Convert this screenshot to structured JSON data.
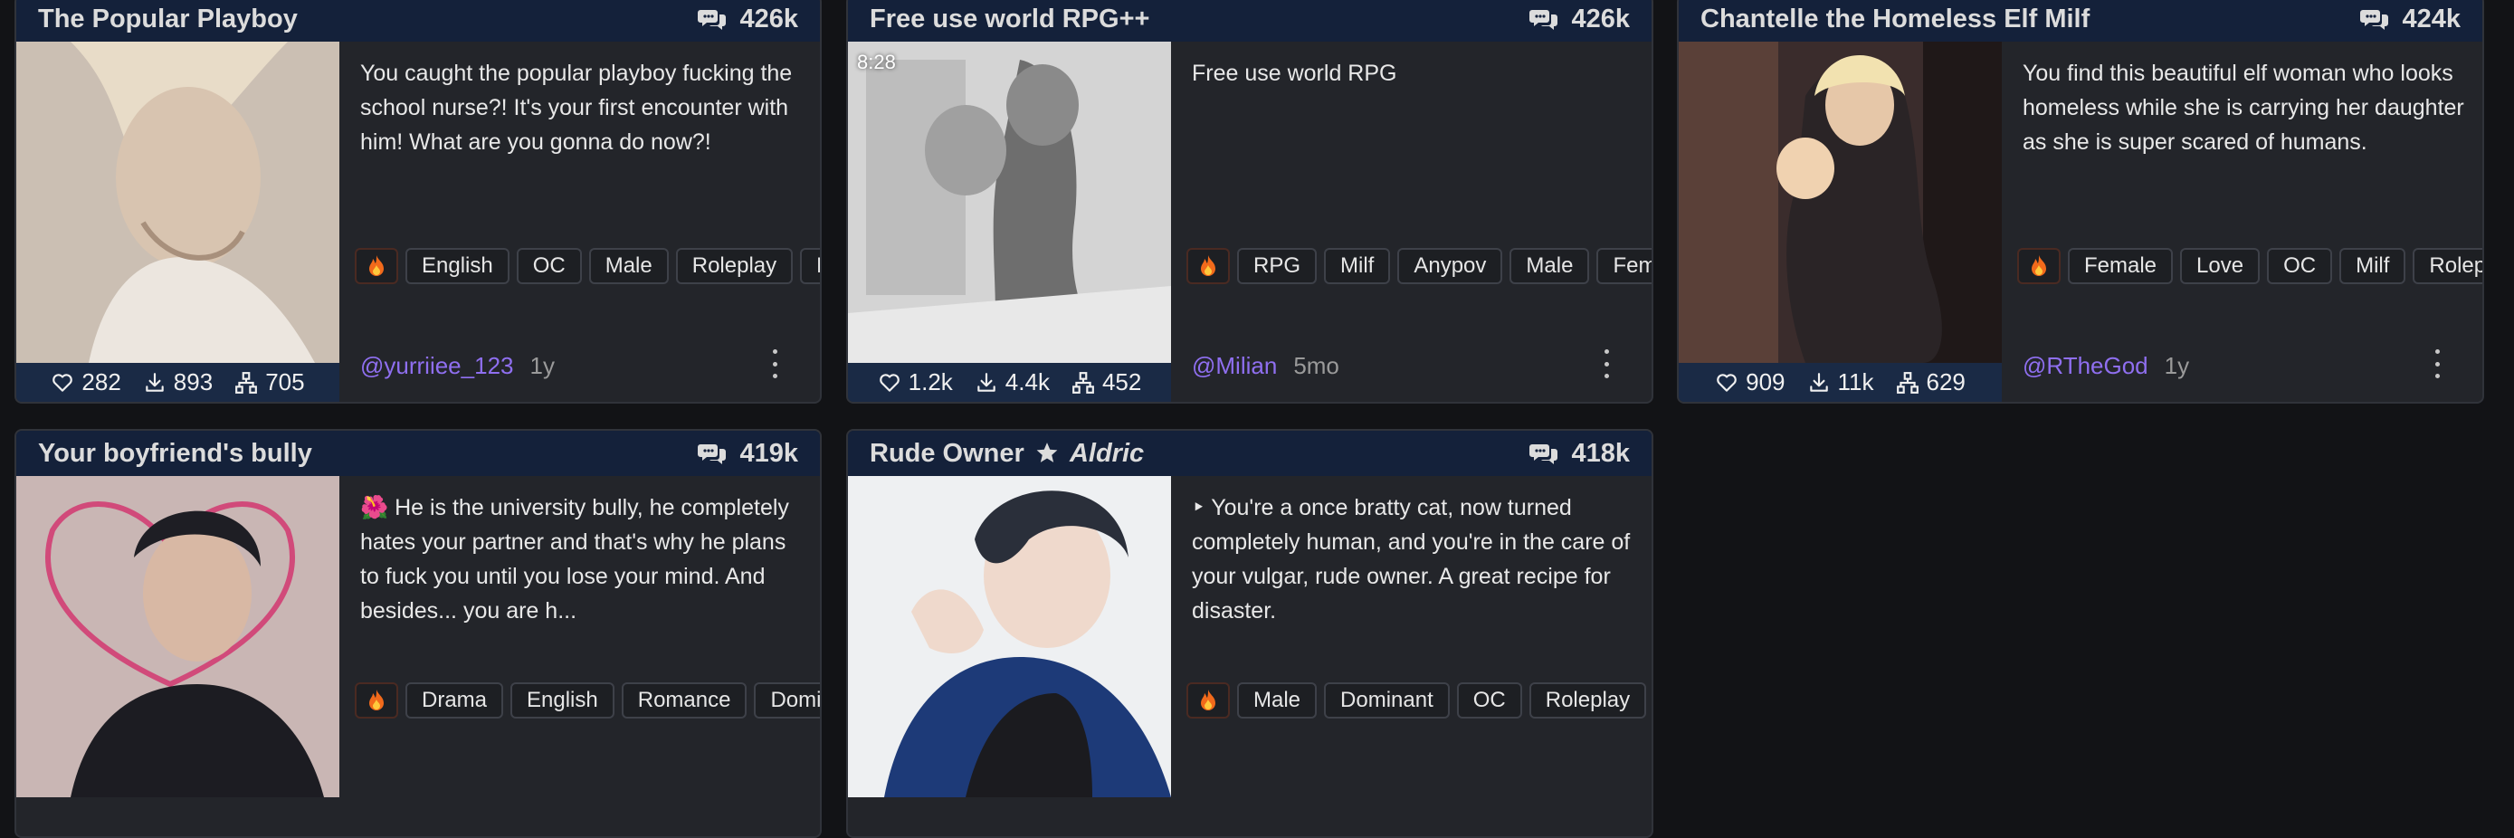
{
  "cards": [
    {
      "title": "The Popular Playboy",
      "chats": "426k",
      "description": "You caught the popular playboy fucking the school nurse?! It's your first encounter with him! What are you gonna do now?!",
      "tags": [
        "English",
        "OC",
        "Male",
        "Roleplay",
        "Dom"
      ],
      "likes": "282",
      "downloads": "893",
      "forks": "705",
      "author": "@yurriiee_123",
      "age": "1y"
    },
    {
      "title": "Free use world RPG++",
      "chats": "426k",
      "duration": "8:28",
      "description": "Free use world RPG",
      "tags": [
        "RPG",
        "Milf",
        "Anypov",
        "Male",
        "Female"
      ],
      "likes": "1.2k",
      "downloads": "4.4k",
      "forks": "452",
      "author": "@Milian",
      "age": "5mo"
    },
    {
      "title": "Chantelle the Homeless Elf Milf",
      "chats": "424k",
      "description": "You find this beautiful elf woman who looks homeless while she is carrying her daughter as she is super scared of humans.",
      "tags": [
        "Female",
        "Love",
        "OC",
        "Milf",
        "Roleplay"
      ],
      "likes": "909",
      "downloads": "11k",
      "forks": "629",
      "author": "@RTheGod",
      "age": "1y"
    },
    {
      "title": "Your boyfriend's bully",
      "chats": "419k",
      "description": "🌺 He is the university bully, he completely hates your partner and that's why he plans to fuck you until you lose your mind. And besides... you are h...",
      "tags": [
        "Drama",
        "English",
        "Romance",
        "Dominant"
      ]
    },
    {
      "title": "Rude Owner",
      "title_sub": "Aldric",
      "chats": "418k",
      "description": "‣ You're a once bratty cat, now turned completely human, and you're in the care of your vulgar, rude owner. A great recipe for disaster.",
      "tags": [
        "Male",
        "Dominant",
        "OC",
        "Roleplay",
        ""
      ]
    }
  ],
  "colors": {
    "header_bg": "#14213a",
    "card_bg": "#23252a",
    "author": "#8f6ff0",
    "page_bg": "#121316"
  },
  "icons": [
    "chat-bubbles-icon",
    "heart-icon",
    "download-icon",
    "fork-icon",
    "fire-icon",
    "kebab-menu-icon",
    "star-icon"
  ]
}
